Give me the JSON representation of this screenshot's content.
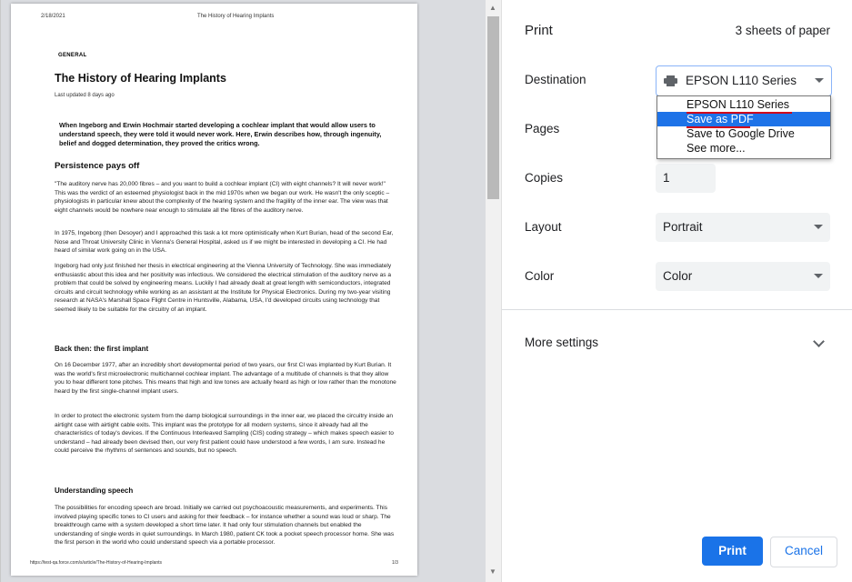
{
  "preview": {
    "date": "2/18/2021",
    "header_title": "The History of Hearing Implants",
    "category": "GENERAL",
    "article_title": "The History of Hearing Implants",
    "updated": "Last updated 8 days ago",
    "lead": "When Ingeborg and Erwin Hochmair started developing a cochlear implant that would allow users to understand speech, they were told it would never work. Here, Erwin describes how, through ingenuity, belief and dogged determination, they proved the critics wrong.",
    "section1_heading": "Persistence pays off",
    "p1": "\"The auditory nerve has 20,000 fibres – and you want to build a cochlear implant (CI) with eight channels? It will never work!\" This was the verdict of an esteemed physiologist back in the mid 1970s when we began our work. He wasn't the only sceptic – physiologists in particular knew about the complexity of the hearing system and the fragility of the inner ear. The view was that eight channels would be nowhere near enough to stimulate all the fibres of the auditory nerve.",
    "p2": "In 1975, Ingeborg (then Desoyer) and I approached this task a lot more optimistically when Kurt Burian, head of the second Ear, Nose and Throat University Clinic in Vienna's General Hospital, asked us if we might be interested in developing a CI. He had heard of similar work going on in the USA.",
    "p3": "Ingeborg had only just finished her thesis in electrical engineering at the Vienna University of Technology. She was immediately enthusiastic about this idea and her positivity was infectious. We considered the electrical stimulation of the auditory nerve as a problem that could be solved by engineering means. Luckily I had already dealt at great length with semiconductors, integrated circuits and circuit technology while working as an assistant at the Institute for Physical Electronics. During my two-year visiting research at NASA's Marshall Space Flight Centre in Huntsville, Alabama, USA, I'd developed circuits using technology that seemed likely to be suitable for the circuitry of an implant.",
    "section2_heading": "Back then: the first implant",
    "p4": "On 16 December 1977, after an incredibly short developmental period of two years, our first CI was implanted by Kurt Burian. It was the world's first microelectronic multichannel cochlear implant. The advantage of a multitude of channels is that they allow you to hear different tone pitches. This means that high and low tones are actually heard as high or low rather than the monotone heard by the first single-channel implant users.",
    "p5": "In order to protect the electronic system from the damp biological surroundings in the inner ear, we placed the circuitry inside an airtight case with airtight cable exits. This implant was the prototype for all modern systems, since it already had all the characteristics of today's devices. If the Continuous Interleaved Sampling (CIS) coding strategy – which makes speech easier to understand – had already been devised then, our very first patient could have understood a few words, I am sure. Instead he could perceive the rhythms of sentences and sounds, but no speech.",
    "section3_heading": "Understanding speech",
    "p6": "The possibilities for encoding speech are broad. Initially we carried out psychoacoustic measurements, and experiments. This involved playing specific tones to CI users and asking for their feedback – for instance whether a sound was loud or sharp. The breakthrough came with a system developed a short time later. It had only four stimulation channels but enabled the understanding of single words in quiet surroundings. In March 1980, patient CK took a pocket speech processor home. She was the first person in the world who could understand speech via a portable processor.",
    "footer_url": "https://test-qa.force.com/s/article/The-History-of-Hearing-Implants",
    "page_number": "1/3"
  },
  "panel": {
    "title": "Print",
    "sheets": "3 sheets of paper",
    "destination_label": "Destination",
    "destination_value": "EPSON L110 Series",
    "destination_options": [
      "EPSON L110 Series",
      "Save as PDF",
      "Save to Google Drive",
      "See more..."
    ],
    "destination_highlighted": "Save as PDF",
    "pages_label": "Pages",
    "copies_label": "Copies",
    "copies_value": "1",
    "layout_label": "Layout",
    "layout_value": "Portrait",
    "color_label": "Color",
    "color_value": "Color",
    "more_settings": "More settings",
    "print_button": "Print",
    "cancel_button": "Cancel"
  },
  "colors": {
    "accent": "#1a73e8",
    "selected_option": "#1e73e8",
    "annotation_underline": "#d0021b",
    "preview_background": "#dadce0"
  },
  "icons": [
    "printer-icon",
    "chevron-down-icon",
    "dropdown-caret-icon",
    "scroll-up-arrow-icon",
    "scroll-down-arrow-icon"
  ]
}
